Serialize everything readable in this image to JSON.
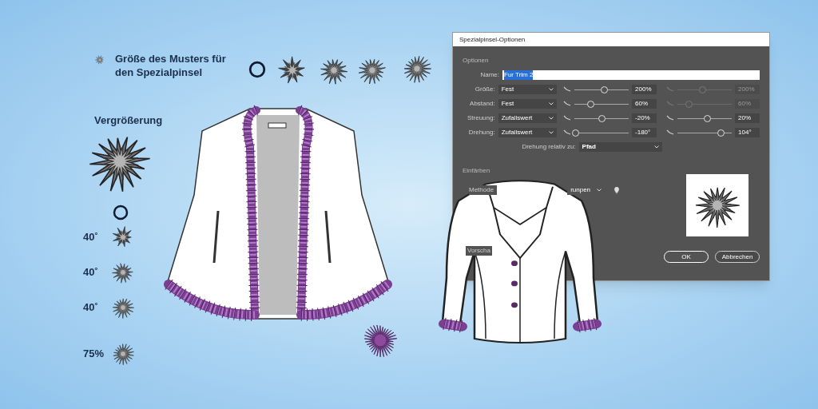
{
  "legend": {
    "title": "Größe des Musters für den Spezialpinsel"
  },
  "magnification": {
    "label": "Vergrößerung"
  },
  "samples": [
    {
      "label": "40˚"
    },
    {
      "label": "40˚"
    },
    {
      "label": "40˚"
    },
    {
      "label": "75%"
    }
  ],
  "dialog": {
    "title": "Spezialpinsel-Optionen",
    "section": "Optionen",
    "name_label": "Name:",
    "name_value": "Fur Trim 2",
    "name_selected": true,
    "rows": [
      {
        "label": "Größe:",
        "mode": "Fest",
        "min": {
          "level": 0.55,
          "value": "200%"
        },
        "max": {
          "level": 0.45,
          "value": "200%",
          "disabled": true
        }
      },
      {
        "label": "Abstand:",
        "mode": "Fest",
        "min": {
          "level": 0.3,
          "value": "60%"
        },
        "max": {
          "level": 0.2,
          "value": "60%",
          "disabled": true
        }
      },
      {
        "label": "Streuung:",
        "mode": "Zufallswert",
        "min": {
          "level": 0.5,
          "value": "-20%"
        },
        "max": {
          "level": 0.55,
          "value": "20%",
          "disabled": false
        }
      },
      {
        "label": "Drehung:",
        "mode": "Zufallswert",
        "min": {
          "level": 0.02,
          "value": "-180°"
        },
        "max": {
          "level": 0.8,
          "value": "104°",
          "disabled": false
        }
      }
    ],
    "rotation_label": "Drehung relativ zu:",
    "rotation_value": "Pfad",
    "color_section": "Einfärben",
    "method_label": "Methode",
    "method_value": "runpen",
    "preview_label": "Vorscha",
    "buttons": [
      {
        "label": "OK",
        "primary": true
      },
      {
        "label": "Abbrechen",
        "primary": false
      }
    ]
  }
}
